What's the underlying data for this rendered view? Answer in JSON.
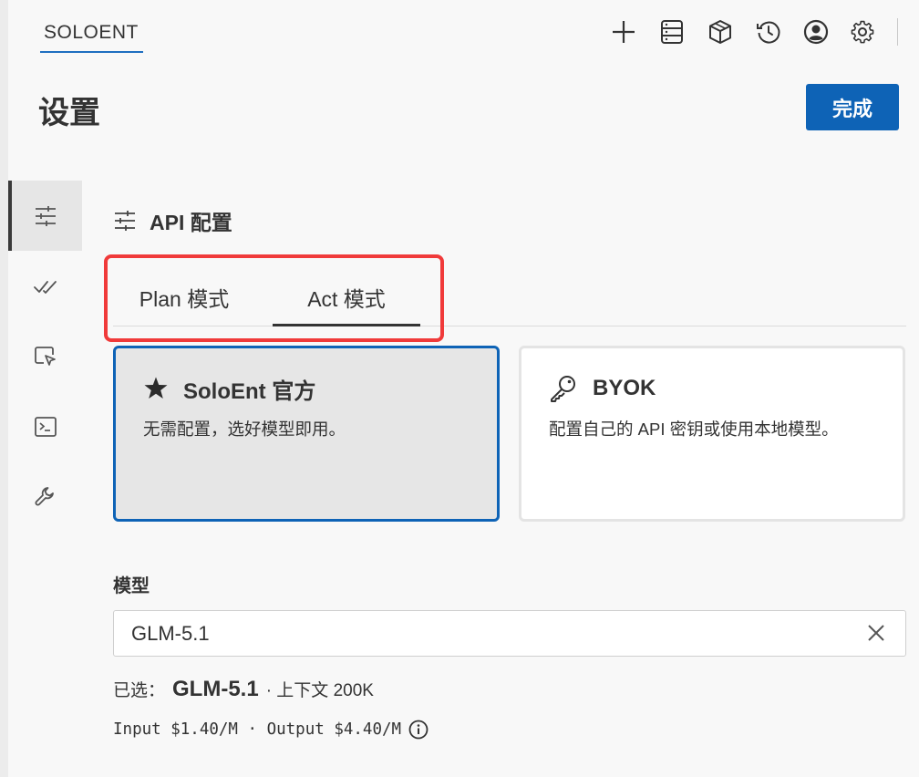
{
  "app": {
    "tab_label": "SOLOENT"
  },
  "toolbar": {
    "icons": [
      "plus-icon",
      "history-list-icon",
      "cube-icon",
      "clock-history-icon",
      "account-icon",
      "gear-icon"
    ]
  },
  "header": {
    "title": "设置",
    "done_label": "完成"
  },
  "sidebar": {
    "items": [
      {
        "icon": "sliders-icon",
        "active": true
      },
      {
        "icon": "double-check-icon",
        "active": false
      },
      {
        "icon": "browser-cursor-icon",
        "active": false
      },
      {
        "icon": "terminal-icon",
        "active": false
      },
      {
        "icon": "wrench-icon",
        "active": false
      }
    ]
  },
  "section": {
    "icon": "sliders-icon",
    "title": "API 配置"
  },
  "mode_tabs": [
    {
      "label": "Plan 模式",
      "active": false
    },
    {
      "label": "Act 模式",
      "active": true
    }
  ],
  "provider_cards": [
    {
      "icon": "star-icon",
      "title": "SoloEnt 官方",
      "description": "无需配置，选好模型即用。",
      "selected": true
    },
    {
      "icon": "key-icon",
      "title": "BYOK",
      "description": "配置自己的 API 密钥或使用本地模型。",
      "selected": false
    }
  ],
  "model": {
    "label": "模型",
    "value": "GLM-5.1",
    "selected_prefix": "已选：",
    "selected_name": "GLM-5.1",
    "selected_context": "· 上下文 200K",
    "pricing": "Input $1.40/M · Output $4.40/M"
  },
  "colors": {
    "accent": "#0e63b6",
    "highlight": "#f03a3a",
    "background": "#f8f8f8"
  }
}
